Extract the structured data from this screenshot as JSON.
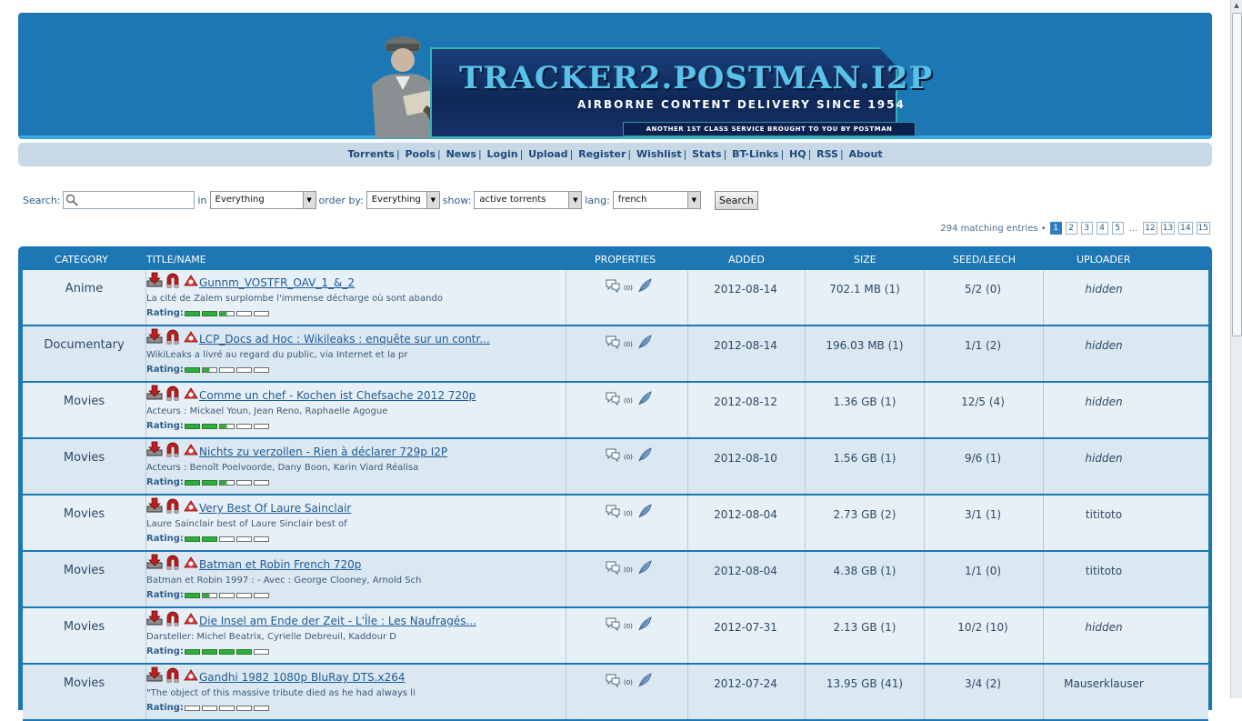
{
  "banner": {
    "title": "TRACKER2.POSTMAN.I2P",
    "subtitle": "AIRBORNE CONTENT DELIVERY SINCE 1954",
    "tagline": "ANOTHER 1ST CLASS SERVICE BROUGHT TO YOU BY POSTMAN"
  },
  "nav": {
    "items": [
      "Torrents",
      "Pools",
      "News",
      "Login",
      "Upload",
      "Register",
      "Wishlist",
      "Stats",
      "BT-Links",
      "HQ",
      "RSS",
      "About"
    ]
  },
  "search": {
    "label": "Search:",
    "query": "",
    "in_label": "in",
    "in_value": "Everything",
    "order_label": "order by:",
    "order_value": "Everything",
    "show_label": "show:",
    "show_value": "active torrents",
    "lang_label": "lang:",
    "lang_value": "french",
    "button": "Search"
  },
  "pagination": {
    "summary": "294 matching entries •",
    "pages_start": [
      "1",
      "2",
      "3",
      "4",
      "5"
    ],
    "ellipsis": "...",
    "pages_end": [
      "12",
      "13",
      "14",
      "15"
    ],
    "active": "1"
  },
  "table": {
    "headers": {
      "category": "CATEGORY",
      "title": "TITLE/NAME",
      "properties": "PROPERTIES",
      "added": "ADDED",
      "size": "SIZE",
      "seedleech": "SEED/LEECH",
      "uploader": "UPLOADER"
    },
    "rating_label": "Rating:",
    "comment_count_label": "(0)",
    "rows": [
      {
        "category": "Anime",
        "title": "Gunnm_VOSTFR_OAV_1_&_2",
        "desc": "La cité de Zalem surplombe l'immense décharge où sont abando",
        "rating": 2.5,
        "added": "2012-08-14",
        "size": "702.1 MB (1)",
        "seed": "5/2 (0)",
        "uploader": "hidden"
      },
      {
        "category": "Documentary",
        "title": "LCP_Docs ad Hoc : Wikileaks : enquête sur un contr...",
        "desc": "WikiLeaks a livré au regard du public, via Internet et la pr",
        "rating": 1.5,
        "added": "2012-08-14",
        "size": "196.03 MB (1)",
        "seed": "1/1 (2)",
        "uploader": "hidden"
      },
      {
        "category": "Movies",
        "title": "Comme un chef - Kochen ist Chefsache 2012 720p",
        "desc": "Acteurs : Mickael Youn, Jean Reno, Raphaelle Agogue",
        "rating": 2.5,
        "added": "2012-08-12",
        "size": "1.36 GB (1)",
        "seed": "12/5 (4)",
        "uploader": "hidden"
      },
      {
        "category": "Movies",
        "title": "Nichts zu verzollen - Rien à déclarer 729p I2P",
        "desc": "Acteurs : Benoît Poelvoorde, Dany Boon, Karin Viard Réalisa",
        "rating": 2.5,
        "added": "2012-08-10",
        "size": "1.56 GB (1)",
        "seed": "9/6 (1)",
        "uploader": "hidden"
      },
      {
        "category": "Movies",
        "title": "Very Best Of Laure Sainclair",
        "desc": "Laure Sainclair best of Laure Sinclair best of",
        "rating": 2,
        "added": "2012-08-04",
        "size": "2.73 GB (2)",
        "seed": "3/1 (1)",
        "uploader": "tititoto"
      },
      {
        "category": "Movies",
        "title": "Batman et Robin French 720p",
        "desc": "Batman et Robin 1997 : - Avec : George Clooney, Arnold Sch",
        "rating": 1.5,
        "added": "2012-08-04",
        "size": "4.38 GB (1)",
        "seed": "1/1 (0)",
        "uploader": "tititoto"
      },
      {
        "category": "Movies",
        "title": "Die Insel am Ende der Zeit - L'Île : Les Naufragés...",
        "desc": "Darsteller: Michel Beatrix, Cyrielle Debreuil, Kaddour D",
        "rating": 4,
        "added": "2012-07-31",
        "size": "2.13 GB (1)",
        "seed": "10/2 (10)",
        "uploader": "hidden"
      },
      {
        "category": "Movies",
        "title": "Gandhi 1982 1080p BluRay DTS.x264",
        "desc": "\"The object of this massive tribute died as he had always li",
        "rating": 0,
        "added": "2012-07-24",
        "size": "13.95 GB (41)",
        "seed": "3/4 (2)",
        "uploader": "Mauserklauser"
      }
    ]
  },
  "colors": {
    "banner_bg": "#1d77b4",
    "nav_bg": "#c7d8e7",
    "rating_green": "#2fae3b",
    "link": "#1e5c96"
  },
  "icons": [
    "search-icon",
    "download-icon",
    "magnet-icon",
    "report-icon",
    "comments-icon",
    "feather-icon"
  ]
}
